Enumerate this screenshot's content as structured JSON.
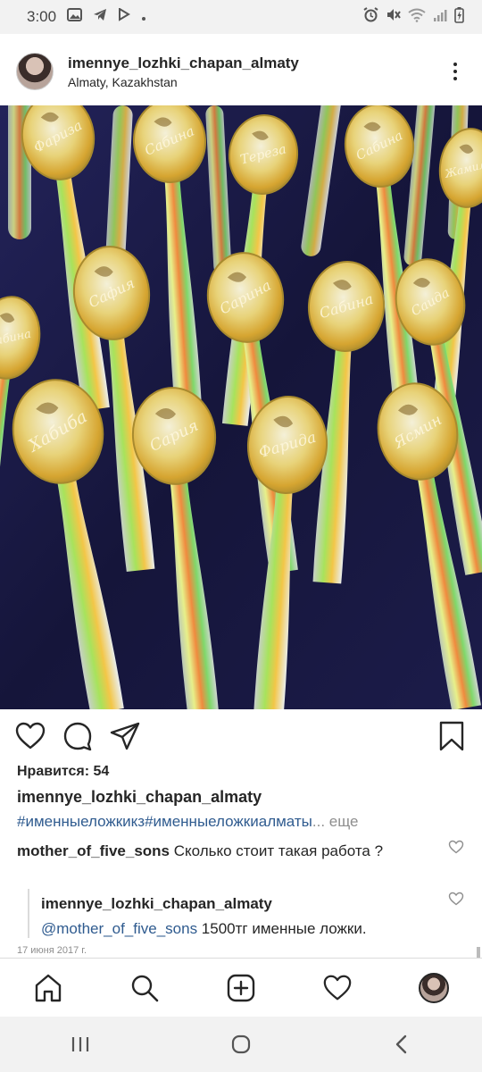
{
  "status_bar": {
    "time": "3:00",
    "left_icons": [
      "image-icon",
      "telegram-icon",
      "download-icon",
      "dot-icon"
    ],
    "right_icons": [
      "alarm-icon",
      "mute-icon",
      "wifi-icon",
      "signal-icon",
      "battery-icon"
    ]
  },
  "post": {
    "username": "imennye_lozhki_chapan_almaty",
    "location": "Almaty, Kazakhstan",
    "photo": {
      "description_icon": "photo-of-engraved-spoons",
      "spoon_names": [
        "Фариза",
        "Сабина",
        "Тереза",
        "Сабина",
        "Жамиля",
        "Сабина",
        "Сафия",
        "Сарина",
        "Сабина",
        "Саида",
        "Хабиба",
        "Сария",
        "Фарида",
        "Ясмин"
      ]
    },
    "likes": "Нравится: 54",
    "caption_user": "imennye_lozhki_chapan_almaty",
    "caption_tags": "#именныеложкикз#именныеложкиалматы",
    "caption_more": "... еще",
    "comments": [
      {
        "user": "mother_of_five_sons",
        "text": "Сколько стоит такая работа ?"
      }
    ],
    "reply": {
      "user": "imennye_lozhki_chapan_almaty",
      "mention": "@mother_of_five_sons",
      "text": " 1500тг именные ложки."
    },
    "date": "17 июня 2017 г."
  },
  "colors": {
    "link": "#2f5b8f",
    "text": "#262626",
    "muted": "#8e8e8e",
    "photo_background": "#141433"
  }
}
